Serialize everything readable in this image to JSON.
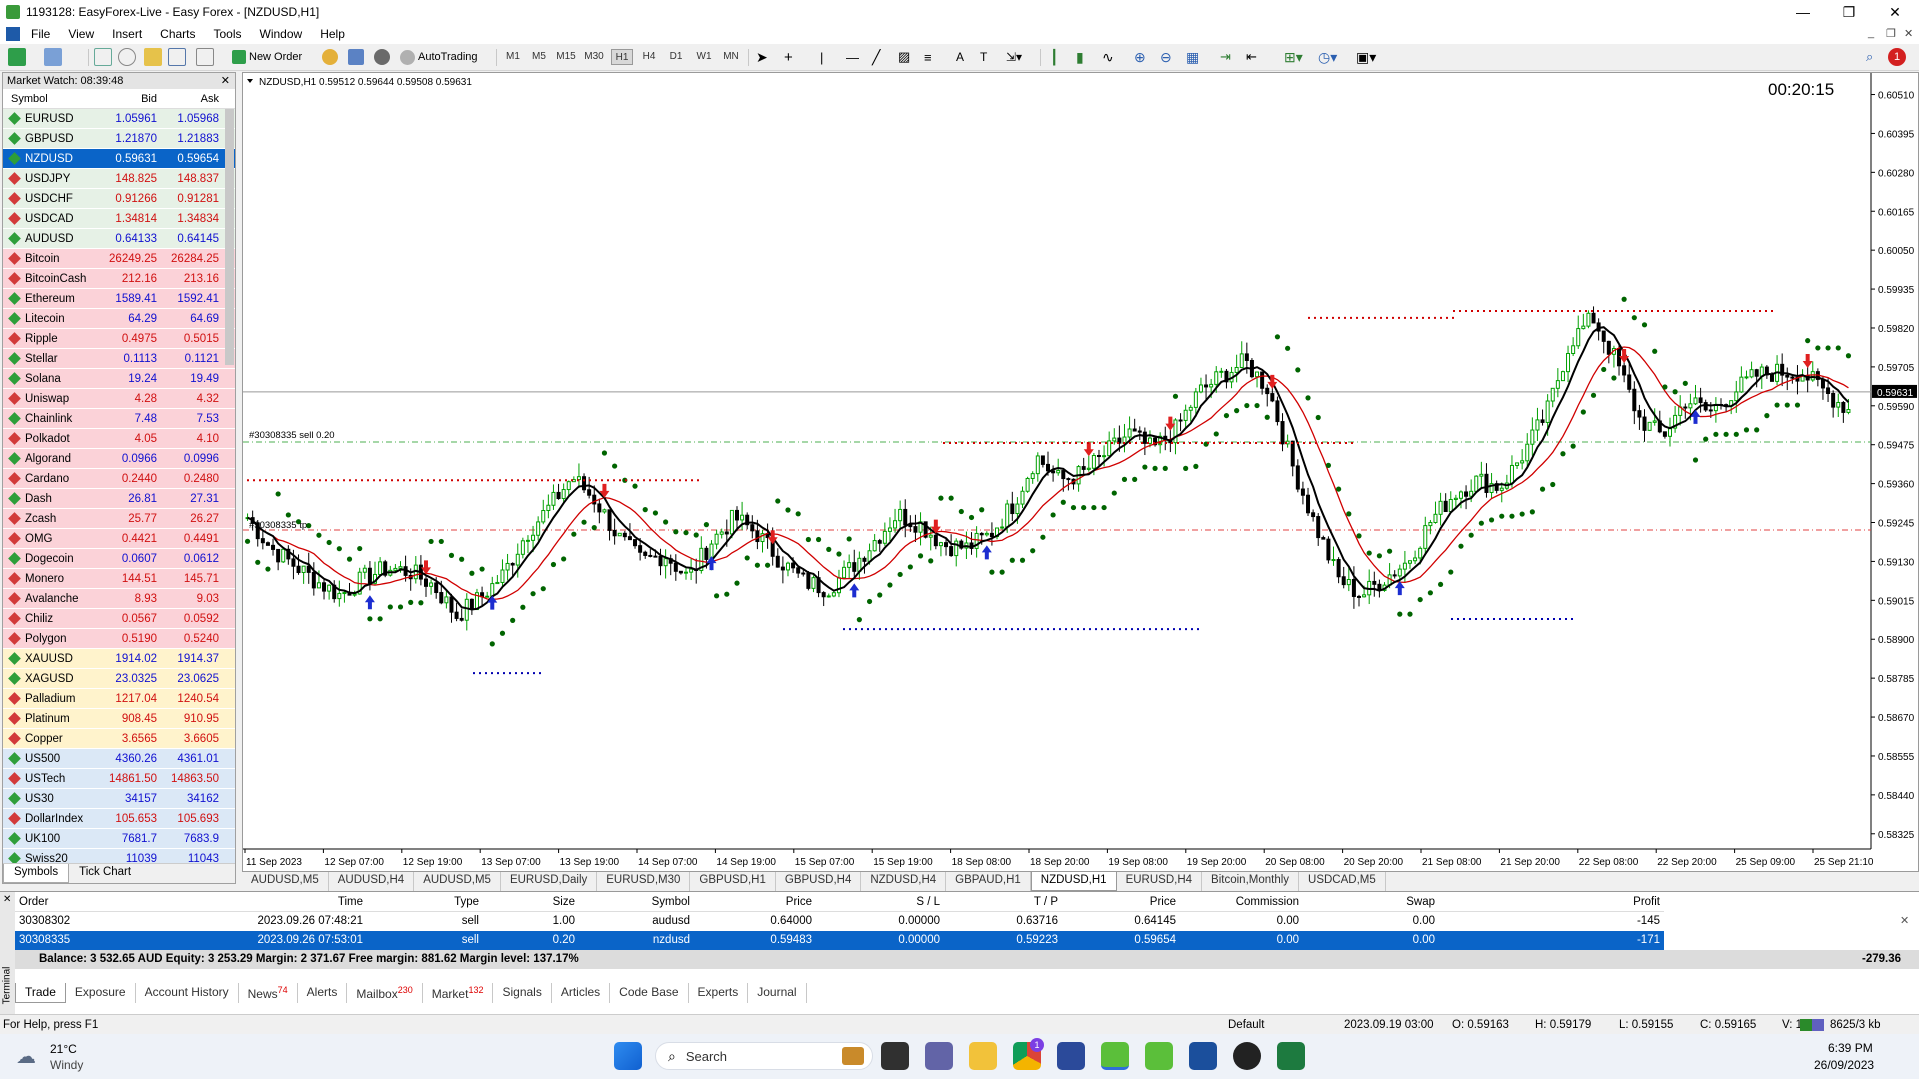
{
  "window": {
    "title": "1193128: EasyForex-Live - Easy Forex - [NZDUSD,H1]",
    "minimize": "—",
    "maximize": "❐",
    "close": "✕"
  },
  "menu": [
    "File",
    "View",
    "Insert",
    "Charts",
    "Tools",
    "Window",
    "Help"
  ],
  "toolbar": {
    "new_order": "New Order",
    "autotrading": "AutoTrading",
    "timeframes": [
      "M1",
      "M5",
      "M15",
      "M30",
      "H1",
      "H4",
      "D1",
      "W1",
      "MN"
    ],
    "active_timeframe": "H1",
    "notification_count": "1"
  },
  "market_watch": {
    "title": "Market Watch: 08:39:48",
    "columns": [
      "Symbol",
      "Bid",
      "Ask"
    ],
    "rows": [
      {
        "symbol": "EURUSD",
        "bid": "1.05961",
        "ask": "1.05968",
        "kind": "fx",
        "dir": "up"
      },
      {
        "symbol": "GBPUSD",
        "bid": "1.21870",
        "ask": "1.21883",
        "kind": "fx",
        "dir": "up"
      },
      {
        "symbol": "NZDUSD",
        "bid": "0.59631",
        "ask": "0.59654",
        "kind": "fx",
        "dir": "up",
        "selected": true
      },
      {
        "symbol": "USDJPY",
        "bid": "148.825",
        "ask": "148.837",
        "kind": "fx",
        "dir": "down"
      },
      {
        "symbol": "USDCHF",
        "bid": "0.91266",
        "ask": "0.91281",
        "kind": "fx",
        "dir": "down"
      },
      {
        "symbol": "USDCAD",
        "bid": "1.34814",
        "ask": "1.34834",
        "kind": "fx",
        "dir": "down"
      },
      {
        "symbol": "AUDUSD",
        "bid": "0.64133",
        "ask": "0.64145",
        "kind": "fx",
        "dir": "up"
      },
      {
        "symbol": "Bitcoin",
        "bid": "26249.25",
        "ask": "26284.25",
        "kind": "crypto",
        "dir": "down"
      },
      {
        "symbol": "BitcoinCash",
        "bid": "212.16",
        "ask": "213.16",
        "kind": "crypto",
        "dir": "down"
      },
      {
        "symbol": "Ethereum",
        "bid": "1589.41",
        "ask": "1592.41",
        "kind": "crypto",
        "dir": "up"
      },
      {
        "symbol": "Litecoin",
        "bid": "64.29",
        "ask": "64.69",
        "kind": "crypto",
        "dir": "up"
      },
      {
        "symbol": "Ripple",
        "bid": "0.4975",
        "ask": "0.5015",
        "kind": "crypto",
        "dir": "down"
      },
      {
        "symbol": "Stellar",
        "bid": "0.1113",
        "ask": "0.1121",
        "kind": "crypto",
        "dir": "up"
      },
      {
        "symbol": "Solana",
        "bid": "19.24",
        "ask": "19.49",
        "kind": "crypto",
        "dir": "up"
      },
      {
        "symbol": "Uniswap",
        "bid": "4.28",
        "ask": "4.32",
        "kind": "crypto",
        "dir": "down"
      },
      {
        "symbol": "Chainlink",
        "bid": "7.48",
        "ask": "7.53",
        "kind": "crypto",
        "dir": "up"
      },
      {
        "symbol": "Polkadot",
        "bid": "4.05",
        "ask": "4.10",
        "kind": "crypto",
        "dir": "down"
      },
      {
        "symbol": "Algorand",
        "bid": "0.0966",
        "ask": "0.0996",
        "kind": "crypto",
        "dir": "up"
      },
      {
        "symbol": "Cardano",
        "bid": "0.2440",
        "ask": "0.2480",
        "kind": "crypto",
        "dir": "down"
      },
      {
        "symbol": "Dash",
        "bid": "26.81",
        "ask": "27.31",
        "kind": "crypto",
        "dir": "up"
      },
      {
        "symbol": "Zcash",
        "bid": "25.77",
        "ask": "26.27",
        "kind": "crypto",
        "dir": "down"
      },
      {
        "symbol": "OMG",
        "bid": "0.4421",
        "ask": "0.4491",
        "kind": "crypto",
        "dir": "down"
      },
      {
        "symbol": "Dogecoin",
        "bid": "0.0607",
        "ask": "0.0612",
        "kind": "crypto",
        "dir": "up"
      },
      {
        "symbol": "Monero",
        "bid": "144.51",
        "ask": "145.71",
        "kind": "crypto",
        "dir": "down"
      },
      {
        "symbol": "Avalanche",
        "bid": "8.93",
        "ask": "9.03",
        "kind": "crypto",
        "dir": "down"
      },
      {
        "symbol": "Chiliz",
        "bid": "0.0567",
        "ask": "0.0592",
        "kind": "crypto",
        "dir": "down"
      },
      {
        "symbol": "Polygon",
        "bid": "0.5190",
        "ask": "0.5240",
        "kind": "crypto",
        "dir": "down"
      },
      {
        "symbol": "XAUUSD",
        "bid": "1914.02",
        "ask": "1914.37",
        "kind": "metal",
        "dir": "up"
      },
      {
        "symbol": "XAGUSD",
        "bid": "23.0325",
        "ask": "23.0625",
        "kind": "metal",
        "dir": "up"
      },
      {
        "symbol": "Palladium",
        "bid": "1217.04",
        "ask": "1240.54",
        "kind": "metal",
        "dir": "down"
      },
      {
        "symbol": "Platinum",
        "bid": "908.45",
        "ask": "910.95",
        "kind": "metal",
        "dir": "down"
      },
      {
        "symbol": "Copper",
        "bid": "3.6565",
        "ask": "3.6605",
        "kind": "metal",
        "dir": "down"
      },
      {
        "symbol": "US500",
        "bid": "4360.26",
        "ask": "4361.01",
        "kind": "index",
        "dir": "up"
      },
      {
        "symbol": "USTech",
        "bid": "14861.50",
        "ask": "14863.50",
        "kind": "index",
        "dir": "down"
      },
      {
        "symbol": "US30",
        "bid": "34157",
        "ask": "34162",
        "kind": "index",
        "dir": "up"
      },
      {
        "symbol": "DollarIndex",
        "bid": "105.653",
        "ask": "105.693",
        "kind": "index",
        "dir": "down"
      },
      {
        "symbol": "UK100",
        "bid": "7681.7",
        "ask": "7683.9",
        "kind": "index",
        "dir": "up"
      },
      {
        "symbol": "Swiss20",
        "bid": "11039",
        "ask": "11043",
        "kind": "index",
        "dir": "up"
      }
    ],
    "tabs": [
      "Symbols",
      "Tick Chart"
    ]
  },
  "chart": {
    "header": "NZDUSD,H1  0.59512 0.59644 0.59508 0.59631",
    "countdown": "00:20:15",
    "current_price": "0.59631",
    "order_label_sell": "#30308335 sell 0.20",
    "order_label_tp": "#30308335 tp",
    "colors": {
      "bull": "#00a000",
      "bear": "#000000",
      "ma_fast": "#000000",
      "ma_slow": "#d00000",
      "sar": "#006400",
      "resistance": "#d00000",
      "support": "#0000b0"
    },
    "chart_data": {
      "type": "candlestick",
      "price_axis": [
        "0.60510",
        "0.60395",
        "0.60280",
        "0.60165",
        "0.60050",
        "0.59935",
        "0.59820",
        "0.59705",
        "0.59590",
        "0.59475",
        "0.59360",
        "0.59245",
        "0.59130",
        "0.59015",
        "0.58900",
        "0.58785",
        "0.58670",
        "0.58555",
        "0.58440",
        "0.58325"
      ],
      "time_axis": [
        "11 Sep 2023",
        "12 Sep 07:00",
        "12 Sep 19:00",
        "13 Sep 07:00",
        "13 Sep 19:00",
        "14 Sep 07:00",
        "14 Sep 19:00",
        "15 Sep 07:00",
        "15 Sep 19:00",
        "18 Sep 08:00",
        "18 Sep 20:00",
        "19 Sep 08:00",
        "19 Sep 20:00",
        "20 Sep 08:00",
        "20 Sep 20:00",
        "21 Sep 08:00",
        "21 Sep 20:00",
        "22 Sep 08:00",
        "22 Sep 20:00",
        "25 Sep 09:00",
        "25 Sep 21:10"
      ],
      "ylim": [
        0.5828,
        0.6055
      ],
      "levels": {
        "sell_price": 0.59483,
        "take_profit": 0.59223,
        "current": 0.59631
      },
      "close_path": [
        0.5926,
        0.5917,
        0.5912,
        0.5907,
        0.5903,
        0.5908,
        0.5911,
        0.591,
        0.5906,
        0.5897,
        0.5902,
        0.5909,
        0.5921,
        0.5929,
        0.5938,
        0.5931,
        0.592,
        0.5913,
        0.5915,
        0.5908,
        0.5919,
        0.5926,
        0.5921,
        0.5913,
        0.5907,
        0.5905,
        0.5911,
        0.5919,
        0.5927,
        0.5924,
        0.5918,
        0.5917,
        0.5921,
        0.593,
        0.5944,
        0.5937,
        0.5939,
        0.5945,
        0.5951,
        0.5946,
        0.5952,
        0.5963,
        0.5968,
        0.5972,
        0.5964,
        0.5942,
        0.5924,
        0.5908,
        0.5903,
        0.5908,
        0.5913,
        0.5925,
        0.5933,
        0.5937,
        0.5935,
        0.5945,
        0.5957,
        0.5978,
        0.5985,
        0.5972,
        0.5955,
        0.595,
        0.5961,
        0.5957,
        0.5963,
        0.5968,
        0.5969,
        0.5969,
        0.5963,
        0.5958
      ]
    }
  },
  "chart_tabs": [
    "AUDUSD,M5",
    "AUDUSD,H4",
    "AUDUSD,M5",
    "EURUSD,Daily",
    "EURUSD,M30",
    "GBPUSD,H1",
    "GBPUSD,H4",
    "NZDUSD,H4",
    "GBPAUD,H1",
    "NZDUSD,H1",
    "EURUSD,H4",
    "Bitcoin,Monthly",
    "USDCAD,M5"
  ],
  "active_chart_tab": "NZDUSD,H1",
  "terminal": {
    "columns": [
      "Order",
      "Time",
      "Type",
      "Size",
      "Symbol",
      "Price",
      "S / L",
      "T / P",
      "Price",
      "Commission",
      "Swap",
      "Profit"
    ],
    "orders": [
      {
        "order": "30308302",
        "time": "2023.09.26 07:48:21",
        "type": "sell",
        "size": "1.00",
        "symbol": "audusd",
        "price": "0.64000",
        "sl": "0.00000",
        "tp": "0.63716",
        "cur": "0.64145",
        "commission": "0.00",
        "swap": "0.00",
        "profit": "-145"
      },
      {
        "order": "30308335",
        "time": "2023.09.26 07:53:01",
        "type": "sell",
        "size": "0.20",
        "symbol": "nzdusd",
        "price": "0.59483",
        "sl": "0.00000",
        "tp": "0.59223",
        "cur": "0.59654",
        "commission": "0.00",
        "swap": "0.00",
        "profit": "-171"
      }
    ],
    "balance_line": "Balance: 3 532.65 AUD  Equity: 3 253.29  Margin: 2 371.67  Free margin: 881.62  Margin level: 137.17%",
    "total": "-279.36",
    "tabs": [
      {
        "label": "Trade"
      },
      {
        "label": "Exposure"
      },
      {
        "label": "Account History"
      },
      {
        "label": "News",
        "badge": "74"
      },
      {
        "label": "Alerts"
      },
      {
        "label": "Mailbox",
        "badge": "230"
      },
      {
        "label": "Market",
        "badge": "132"
      },
      {
        "label": "Signals"
      },
      {
        "label": "Articles"
      },
      {
        "label": "Code Base"
      },
      {
        "label": "Experts"
      },
      {
        "label": "Journal"
      }
    ],
    "side_label": "Terminal"
  },
  "statusbar": {
    "help": "For Help, press F1",
    "profile": "Default",
    "bar_time": "2023.09.19 03:00",
    "open": "O: 0.59163",
    "high": "H: 0.59179",
    "low": "L: 0.59155",
    "close": "C: 0.59165",
    "volume": "V: 1018",
    "traffic": "8625/3 kb"
  },
  "taskbar": {
    "temp": "21°C",
    "weather": "Windy",
    "search": "Search",
    "time": "6:39 PM",
    "date": "26/09/2023",
    "chrome_badge": "1"
  }
}
